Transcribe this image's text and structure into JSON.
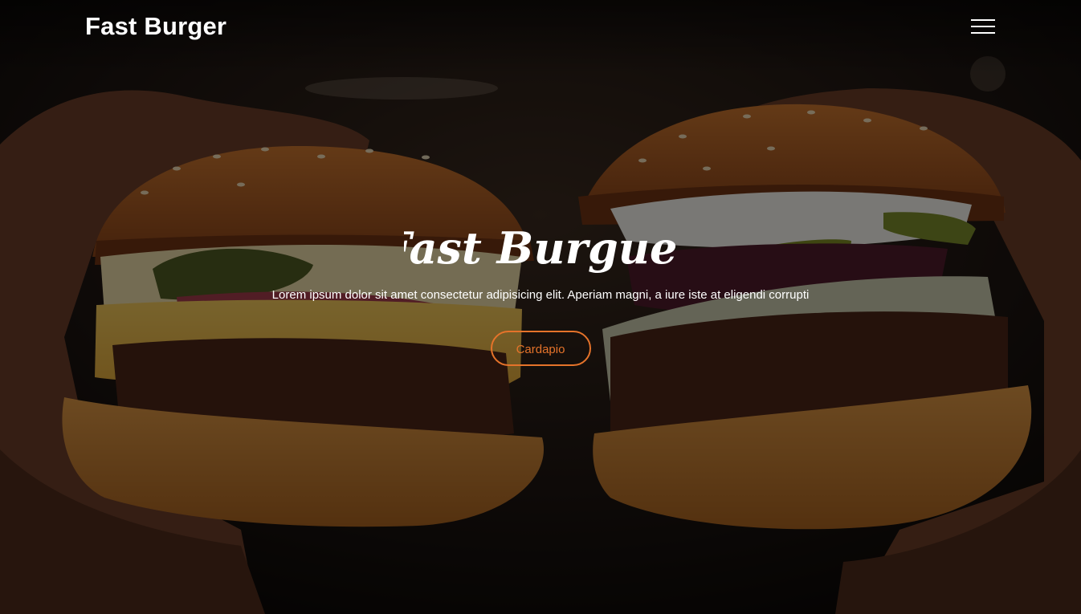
{
  "navbar": {
    "brand": "Fast Burger",
    "menu_icon": "hamburger-menu-icon"
  },
  "hero": {
    "background_image": "two hands holding cheeseburgers",
    "title": "Fast Burguer",
    "text": "Lorem ipsum dolor sit amet consectetur adipisicing elit. Aperiam magni, a iure iste at eligendi corrupti",
    "button_label": "Cardapio"
  },
  "colors": {
    "accent": "#e5732a",
    "text": "#ffffff",
    "overlay": "#000000"
  }
}
